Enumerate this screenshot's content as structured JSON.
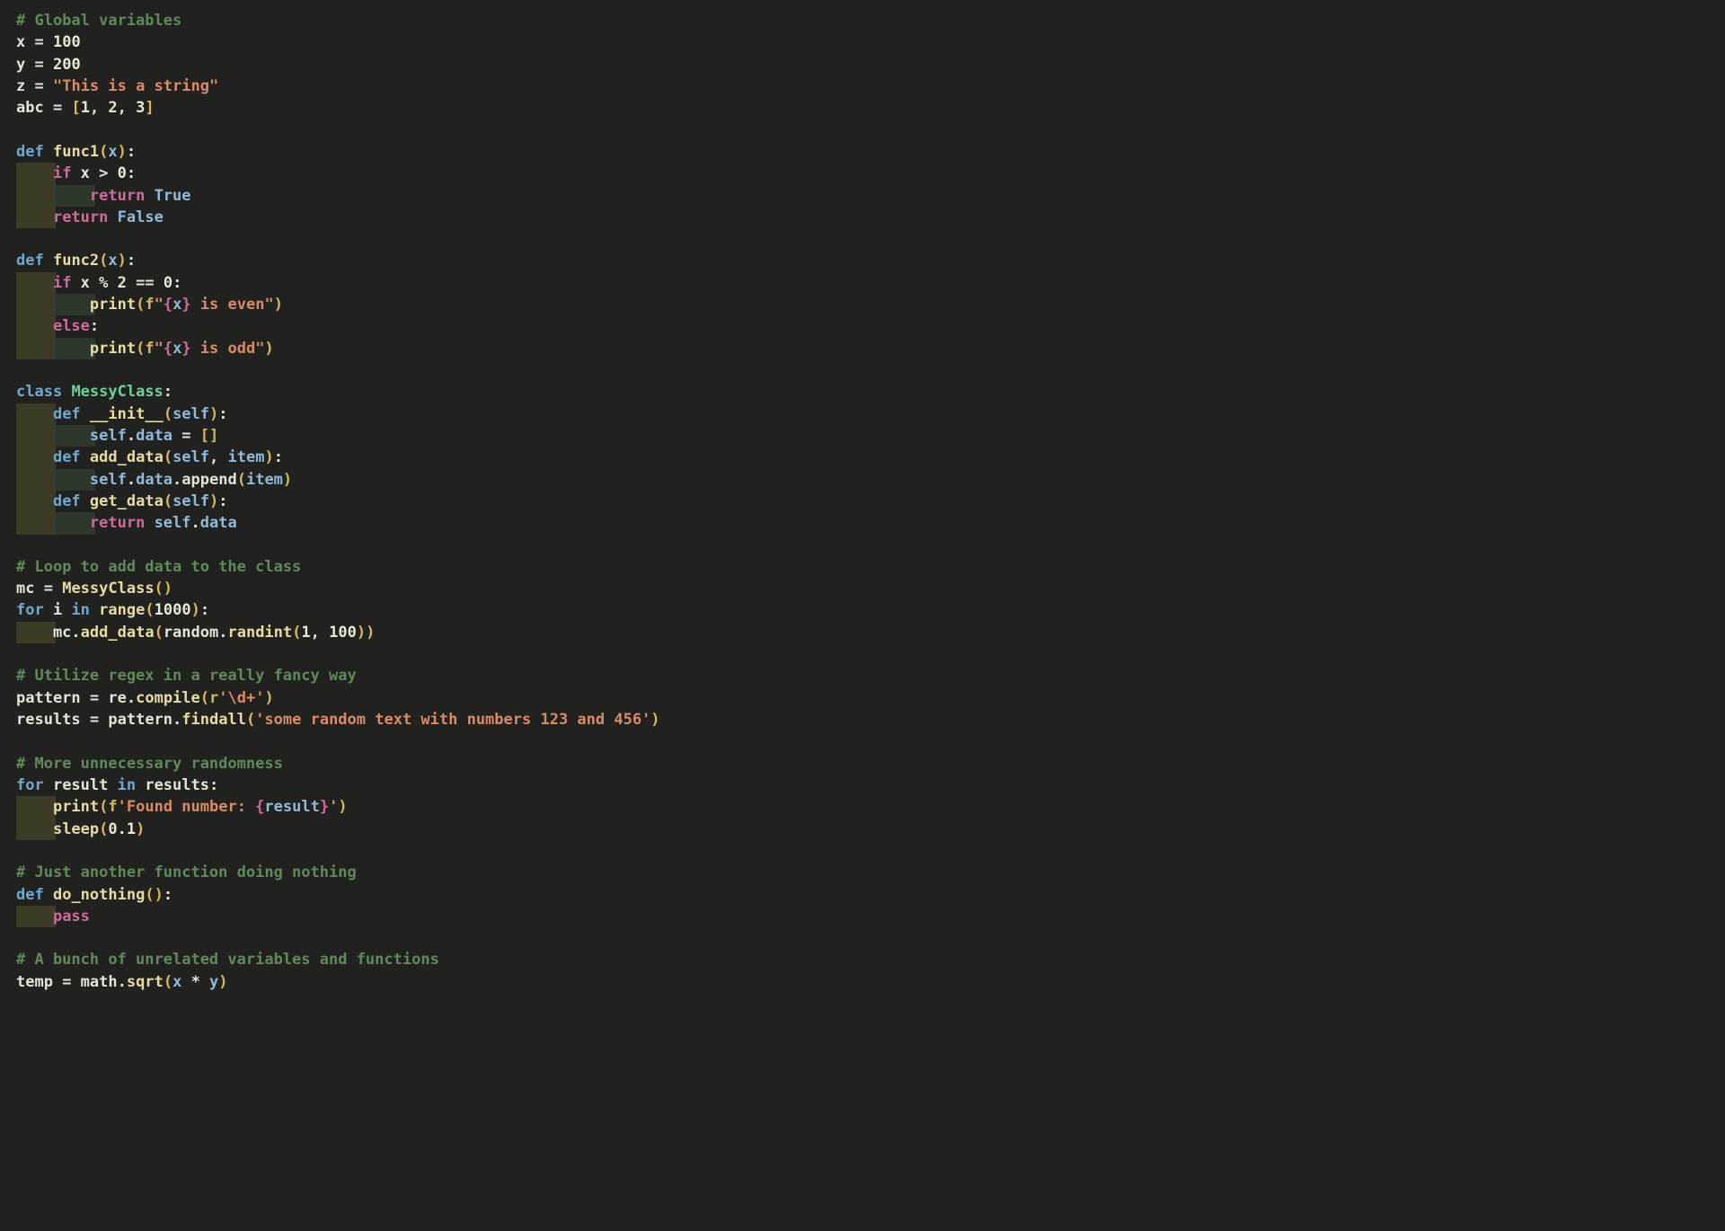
{
  "editor": {
    "language": "python",
    "theme": "dark-olive",
    "font_size_px": 17,
    "line_height_px": 24.32,
    "background": "#21211f",
    "colors": {
      "comment": "#5f8a5a",
      "keyword": "#6fa8d0",
      "keyword_control": "#cf6a9c",
      "function": "#e6dba4",
      "class_name": "#6ecf9a",
      "string": "#d98a66",
      "number": "#e7e7d4",
      "variable": "#8fbada",
      "punctuation": "#d9b85c",
      "text": "#e3e3d8",
      "indent_guide_odd": "#3b3b26",
      "indent_guide_even": "#2e372c"
    }
  },
  "lines": [
    {
      "n": 1,
      "indent": 0,
      "text": "# Global variables"
    },
    {
      "n": 2,
      "indent": 0,
      "text": "x = 100"
    },
    {
      "n": 3,
      "indent": 0,
      "text": "y = 200"
    },
    {
      "n": 4,
      "indent": 0,
      "text": "z = \"This is a string\""
    },
    {
      "n": 5,
      "indent": 0,
      "text": "abc = [1, 2, 3]"
    },
    {
      "n": 6,
      "indent": 0,
      "text": ""
    },
    {
      "n": 7,
      "indent": 0,
      "text": "def func1(x):"
    },
    {
      "n": 8,
      "indent": 1,
      "text": "    if x > 0:"
    },
    {
      "n": 9,
      "indent": 2,
      "text": "        return True"
    },
    {
      "n": 10,
      "indent": 1,
      "text": "    return False"
    },
    {
      "n": 11,
      "indent": 0,
      "text": ""
    },
    {
      "n": 12,
      "indent": 0,
      "text": "def func2(x):"
    },
    {
      "n": 13,
      "indent": 1,
      "text": "    if x % 2 == 0:"
    },
    {
      "n": 14,
      "indent": 2,
      "text": "        print(f\"{x} is even\")"
    },
    {
      "n": 15,
      "indent": 1,
      "text": "    else:"
    },
    {
      "n": 16,
      "indent": 2,
      "text": "        print(f\"{x} is odd\")"
    },
    {
      "n": 17,
      "indent": 0,
      "text": ""
    },
    {
      "n": 18,
      "indent": 0,
      "text": "class MessyClass:"
    },
    {
      "n": 19,
      "indent": 1,
      "text": "    def __init__(self):"
    },
    {
      "n": 20,
      "indent": 2,
      "text": "        self.data = []"
    },
    {
      "n": 21,
      "indent": 1,
      "text": "    def add_data(self, item):"
    },
    {
      "n": 22,
      "indent": 2,
      "text": "        self.data.append(item)"
    },
    {
      "n": 23,
      "indent": 1,
      "text": "    def get_data(self):"
    },
    {
      "n": 24,
      "indent": 2,
      "text": "        return self.data"
    },
    {
      "n": 25,
      "indent": 0,
      "text": ""
    },
    {
      "n": 26,
      "indent": 0,
      "text": "# Loop to add data to the class"
    },
    {
      "n": 27,
      "indent": 0,
      "text": "mc = MessyClass()"
    },
    {
      "n": 28,
      "indent": 0,
      "text": "for i in range(1000):"
    },
    {
      "n": 29,
      "indent": 1,
      "text": "    mc.add_data(random.randint(1, 100))"
    },
    {
      "n": 30,
      "indent": 0,
      "text": ""
    },
    {
      "n": 31,
      "indent": 0,
      "text": "# Utilize regex in a really fancy way"
    },
    {
      "n": 32,
      "indent": 0,
      "text": "pattern = re.compile(r'\\d+')"
    },
    {
      "n": 33,
      "indent": 0,
      "text": "results = pattern.findall('some random text with numbers 123 and 456')"
    },
    {
      "n": 34,
      "indent": 0,
      "text": ""
    },
    {
      "n": 35,
      "indent": 0,
      "text": "# More unnecessary randomness"
    },
    {
      "n": 36,
      "indent": 0,
      "text": "for result in results:"
    },
    {
      "n": 37,
      "indent": 1,
      "text": "    print(f'Found number: {result}')"
    },
    {
      "n": 38,
      "indent": 1,
      "text": "    sleep(0.1)"
    },
    {
      "n": 39,
      "indent": 0,
      "text": ""
    },
    {
      "n": 40,
      "indent": 0,
      "text": "# Just another function doing nothing"
    },
    {
      "n": 41,
      "indent": 0,
      "text": "def do_nothing():"
    },
    {
      "n": 42,
      "indent": 1,
      "text": "    pass"
    },
    {
      "n": 43,
      "indent": 0,
      "text": ""
    },
    {
      "n": 44,
      "indent": 0,
      "text": "# A bunch of unrelated variables and functions"
    },
    {
      "n": 45,
      "indent": 0,
      "text": "temp = math.sqrt(x * y)"
    }
  ],
  "tokens": {
    "l1": [
      [
        "cmt",
        "# Global variables"
      ]
    ],
    "l2": [
      [
        "plain",
        "x"
      ],
      [
        "op",
        " = "
      ],
      [
        "num",
        "100"
      ]
    ],
    "l3": [
      [
        "plain",
        "y"
      ],
      [
        "op",
        " = "
      ],
      [
        "num",
        "200"
      ]
    ],
    "l4": [
      [
        "plain",
        "z"
      ],
      [
        "op",
        " = "
      ],
      [
        "str",
        "\"This is a string\""
      ]
    ],
    "l5": [
      [
        "plain",
        "abc"
      ],
      [
        "op",
        " = "
      ],
      [
        "pun",
        "["
      ],
      [
        "num",
        "1"
      ],
      [
        "op",
        ", "
      ],
      [
        "num",
        "2"
      ],
      [
        "op",
        ", "
      ],
      [
        "num",
        "3"
      ],
      [
        "pun",
        "]"
      ]
    ],
    "l7": [
      [
        "kw",
        "def"
      ],
      [
        "plain",
        " "
      ],
      [
        "fn",
        "func1"
      ],
      [
        "pun",
        "("
      ],
      [
        "var",
        "x"
      ],
      [
        "pun",
        ")"
      ],
      [
        "op",
        ":"
      ]
    ],
    "l8": [
      [
        "plain",
        "    "
      ],
      [
        "kw2",
        "if"
      ],
      [
        "plain",
        " x "
      ],
      [
        "op",
        "> "
      ],
      [
        "num",
        "0"
      ],
      [
        "op",
        ":"
      ]
    ],
    "l9": [
      [
        "plain",
        "        "
      ],
      [
        "kw2",
        "return"
      ],
      [
        "plain",
        " "
      ],
      [
        "var",
        "True"
      ]
    ],
    "l10": [
      [
        "plain",
        "    "
      ],
      [
        "kw2",
        "return"
      ],
      [
        "plain",
        " "
      ],
      [
        "var",
        "False"
      ]
    ],
    "l12": [
      [
        "kw",
        "def"
      ],
      [
        "plain",
        " "
      ],
      [
        "fn",
        "func2"
      ],
      [
        "pun",
        "("
      ],
      [
        "var",
        "x"
      ],
      [
        "pun",
        ")"
      ],
      [
        "op",
        ":"
      ]
    ],
    "l13": [
      [
        "plain",
        "    "
      ],
      [
        "kw2",
        "if"
      ],
      [
        "plain",
        " x "
      ],
      [
        "op",
        "% "
      ],
      [
        "num",
        "2"
      ],
      [
        "op",
        " == "
      ],
      [
        "num",
        "0"
      ],
      [
        "op",
        ":"
      ]
    ],
    "l14": [
      [
        "plain",
        "        "
      ],
      [
        "fn",
        "print"
      ],
      [
        "pun",
        "("
      ],
      [
        "pfx",
        "f"
      ],
      [
        "str",
        "\""
      ],
      [
        "fbr",
        "{"
      ],
      [
        "var",
        "x"
      ],
      [
        "fbr",
        "}"
      ],
      [
        "str",
        " is even\""
      ],
      [
        "pun",
        ")"
      ]
    ],
    "l15": [
      [
        "plain",
        "    "
      ],
      [
        "kw2",
        "else"
      ],
      [
        "op",
        ":"
      ]
    ],
    "l16": [
      [
        "plain",
        "        "
      ],
      [
        "fn",
        "print"
      ],
      [
        "pun",
        "("
      ],
      [
        "pfx",
        "f"
      ],
      [
        "str",
        "\""
      ],
      [
        "fbr",
        "{"
      ],
      [
        "var",
        "x"
      ],
      [
        "fbr",
        "}"
      ],
      [
        "str",
        " is odd\""
      ],
      [
        "pun",
        ")"
      ]
    ],
    "l18": [
      [
        "kw",
        "class"
      ],
      [
        "plain",
        " "
      ],
      [
        "cls",
        "MessyClass"
      ],
      [
        "op",
        ":"
      ]
    ],
    "l19": [
      [
        "plain",
        "    "
      ],
      [
        "kw",
        "def"
      ],
      [
        "plain",
        " "
      ],
      [
        "fn",
        "__init__"
      ],
      [
        "pun",
        "("
      ],
      [
        "var",
        "self"
      ],
      [
        "pun",
        ")"
      ],
      [
        "op",
        ":"
      ]
    ],
    "l20": [
      [
        "plain",
        "        "
      ],
      [
        "var",
        "self"
      ],
      [
        "op",
        "."
      ],
      [
        "var",
        "data"
      ],
      [
        "op",
        " = "
      ],
      [
        "pun",
        "[]"
      ]
    ],
    "l21": [
      [
        "plain",
        "    "
      ],
      [
        "kw",
        "def"
      ],
      [
        "plain",
        " "
      ],
      [
        "fn",
        "add_data"
      ],
      [
        "pun",
        "("
      ],
      [
        "var",
        "self"
      ],
      [
        "op",
        ", "
      ],
      [
        "var",
        "item"
      ],
      [
        "pun",
        ")"
      ],
      [
        "op",
        ":"
      ]
    ],
    "l22": [
      [
        "plain",
        "        "
      ],
      [
        "var",
        "self"
      ],
      [
        "op",
        "."
      ],
      [
        "var",
        "data"
      ],
      [
        "op",
        "."
      ],
      [
        "plain",
        "append"
      ],
      [
        "pun",
        "("
      ],
      [
        "var",
        "item"
      ],
      [
        "pun",
        ")"
      ]
    ],
    "l23": [
      [
        "plain",
        "    "
      ],
      [
        "kw",
        "def"
      ],
      [
        "plain",
        " "
      ],
      [
        "fn",
        "get_data"
      ],
      [
        "pun",
        "("
      ],
      [
        "var",
        "self"
      ],
      [
        "pun",
        ")"
      ],
      [
        "op",
        ":"
      ]
    ],
    "l24": [
      [
        "plain",
        "        "
      ],
      [
        "kw2",
        "return"
      ],
      [
        "plain",
        " "
      ],
      [
        "var",
        "self"
      ],
      [
        "op",
        "."
      ],
      [
        "var",
        "data"
      ]
    ],
    "l26": [
      [
        "cmt",
        "# Loop to add data to the class"
      ]
    ],
    "l27": [
      [
        "plain",
        "mc"
      ],
      [
        "op",
        " = "
      ],
      [
        "fn",
        "MessyClass"
      ],
      [
        "pun",
        "()"
      ]
    ],
    "l28": [
      [
        "kw",
        "for"
      ],
      [
        "plain",
        " i "
      ],
      [
        "kw",
        "in"
      ],
      [
        "plain",
        " "
      ],
      [
        "fn",
        "range"
      ],
      [
        "pun",
        "("
      ],
      [
        "num",
        "1000"
      ],
      [
        "pun",
        ")"
      ],
      [
        "op",
        ":"
      ]
    ],
    "l29": [
      [
        "plain",
        "    mc"
      ],
      [
        "op",
        "."
      ],
      [
        "fn",
        "add_data"
      ],
      [
        "pun",
        "("
      ],
      [
        "plain",
        "random"
      ],
      [
        "op",
        "."
      ],
      [
        "fn",
        "randint"
      ],
      [
        "pun",
        "("
      ],
      [
        "num",
        "1"
      ],
      [
        "op",
        ", "
      ],
      [
        "num",
        "100"
      ],
      [
        "pun",
        "))"
      ]
    ],
    "l31": [
      [
        "cmt",
        "# Utilize regex in a really fancy way"
      ]
    ],
    "l32": [
      [
        "plain",
        "pattern"
      ],
      [
        "op",
        " = "
      ],
      [
        "plain",
        "re"
      ],
      [
        "op",
        "."
      ],
      [
        "fn",
        "compile"
      ],
      [
        "pun",
        "("
      ],
      [
        "pfx",
        "r"
      ],
      [
        "str",
        "'\\d+'"
      ],
      [
        "pun",
        ")"
      ]
    ],
    "l33": [
      [
        "plain",
        "results"
      ],
      [
        "op",
        " = "
      ],
      [
        "plain",
        "pattern"
      ],
      [
        "op",
        "."
      ],
      [
        "fn",
        "findall"
      ],
      [
        "pun",
        "("
      ],
      [
        "str",
        "'some random text with numbers 123 and 456'"
      ],
      [
        "pun",
        ")"
      ]
    ],
    "l35": [
      [
        "cmt",
        "# More unnecessary randomness"
      ]
    ],
    "l36": [
      [
        "kw",
        "for"
      ],
      [
        "plain",
        " result "
      ],
      [
        "kw",
        "in"
      ],
      [
        "plain",
        " results"
      ],
      [
        "op",
        ":"
      ]
    ],
    "l37": [
      [
        "plain",
        "    "
      ],
      [
        "fn",
        "print"
      ],
      [
        "pun",
        "("
      ],
      [
        "pfx",
        "f"
      ],
      [
        "str",
        "'Found number: "
      ],
      [
        "fbr",
        "{"
      ],
      [
        "var",
        "result"
      ],
      [
        "fbr",
        "}"
      ],
      [
        "str",
        "'"
      ],
      [
        "pun",
        ")"
      ]
    ],
    "l38": [
      [
        "plain",
        "    "
      ],
      [
        "fn",
        "sleep"
      ],
      [
        "pun",
        "("
      ],
      [
        "num",
        "0.1"
      ],
      [
        "pun",
        ")"
      ]
    ],
    "l40": [
      [
        "cmt",
        "# Just another function doing nothing"
      ]
    ],
    "l41": [
      [
        "kw",
        "def"
      ],
      [
        "plain",
        " "
      ],
      [
        "fn",
        "do_nothing"
      ],
      [
        "pun",
        "()"
      ],
      [
        "op",
        ":"
      ]
    ],
    "l42": [
      [
        "plain",
        "    "
      ],
      [
        "kw2",
        "pass"
      ]
    ],
    "l44": [
      [
        "cmt",
        "# A bunch of unrelated variables and functions"
      ]
    ],
    "l45": [
      [
        "plain",
        "temp"
      ],
      [
        "op",
        " = "
      ],
      [
        "plain",
        "math"
      ],
      [
        "op",
        "."
      ],
      [
        "fn",
        "sqrt"
      ],
      [
        "pun",
        "("
      ],
      [
        "var",
        "x"
      ],
      [
        "op",
        " * "
      ],
      [
        "var",
        "y"
      ],
      [
        "pun",
        ")"
      ]
    ]
  }
}
